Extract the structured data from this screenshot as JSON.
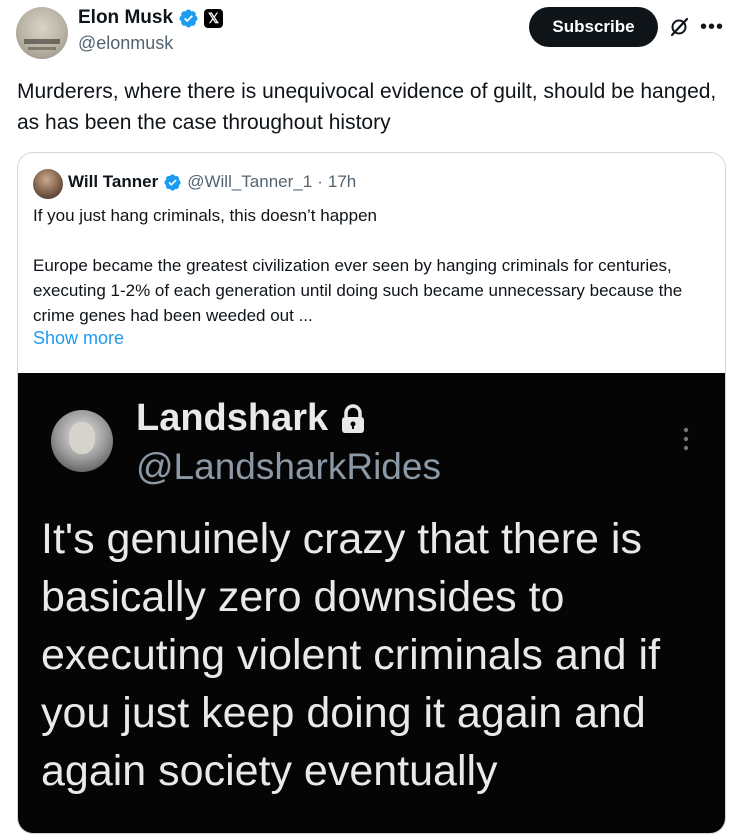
{
  "tweet": {
    "author_name": "Elon Musk",
    "author_handle": "@elonmusk",
    "subscribe_label": "Subscribe",
    "more_glyph": "•••",
    "x_badge_glyph": "𝕏",
    "text": "Murderers, where there is unequivocal evidence of guilt, should be hanged, as has been the case throughout history"
  },
  "quote": {
    "author_name": "Will Tanner",
    "author_handle": "@Will_Tanner_1",
    "separator": "·",
    "timestamp": "17h",
    "paragraph1": "If you just hang criminals, this doesn’t happen",
    "paragraph2": "Europe became the greatest civilization ever seen by hanging criminals for centuries, executing 1-2% of each generation until doing such became unnecessary because the crime genes had been weeded out ...",
    "show_more_label": "Show more"
  },
  "embedded_image": {
    "author_name": "Landshark",
    "author_handle": "@LandsharkRides",
    "text": "It's genuinely crazy that there is basically zero downsides to executing violent criminals and if you just keep doing it again and again society eventually"
  },
  "colors": {
    "accent": "#1d9bf0",
    "subscribe_bg": "#0f1419",
    "secondary_text": "#536471"
  },
  "icons": [
    "verified-badge-icon",
    "x-badge-icon",
    "grok-icon",
    "more-icon",
    "lock-icon"
  ]
}
